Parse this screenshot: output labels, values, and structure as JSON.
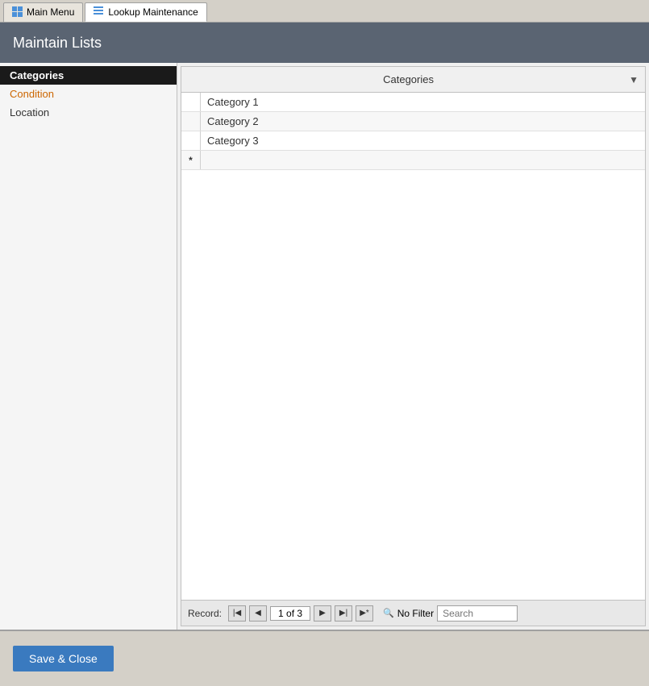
{
  "tabs": [
    {
      "id": "main-menu",
      "label": "Main Menu",
      "active": false,
      "icon": "grid"
    },
    {
      "id": "lookup-maintenance",
      "label": "Lookup Maintenance",
      "active": true,
      "icon": "list"
    }
  ],
  "header": {
    "title": "Maintain Lists"
  },
  "sidebar": {
    "items": [
      {
        "id": "categories",
        "label": "Categories",
        "selected": true
      },
      {
        "id": "condition",
        "label": "Condition",
        "selected": false
      },
      {
        "id": "location",
        "label": "Location",
        "selected": false
      }
    ]
  },
  "grid": {
    "column_header": "Categories",
    "rows": [
      {
        "id": 1,
        "value": "Category 1",
        "indicator": ""
      },
      {
        "id": 2,
        "value": "Category 2",
        "indicator": ""
      },
      {
        "id": 3,
        "value": "Category 3",
        "indicator": ""
      }
    ],
    "new_row_indicator": "*"
  },
  "navigator": {
    "record_label": "Record:",
    "position": "1 of 3",
    "filter_label": "No Filter",
    "search_placeholder": "Search"
  },
  "footer": {
    "save_close_label": "Save & Close"
  }
}
